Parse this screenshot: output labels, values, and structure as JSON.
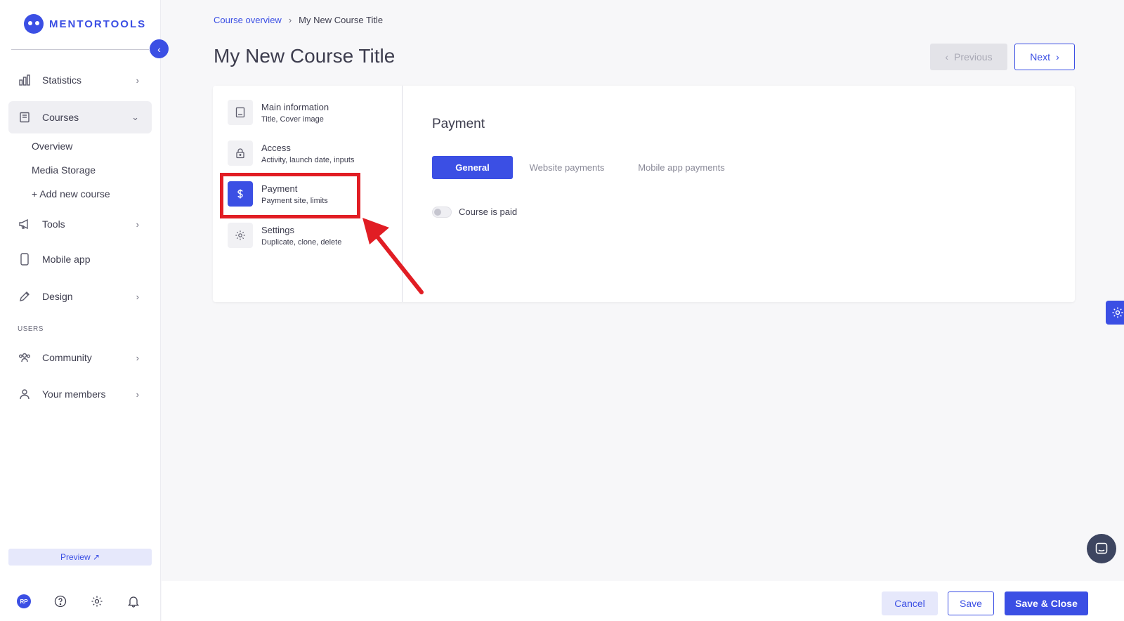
{
  "brand": {
    "name": "MENTORTOOLS",
    "accent": "#3b4fe4"
  },
  "sidebar": {
    "items": [
      {
        "label": "Statistics",
        "icon": "bar-chart-icon"
      },
      {
        "label": "Courses",
        "icon": "book-icon"
      },
      {
        "label": "Tools",
        "icon": "megaphone-icon"
      },
      {
        "label": "Mobile app",
        "icon": "mobile-icon"
      },
      {
        "label": "Design",
        "icon": "pencil-icon"
      },
      {
        "label": "Community",
        "icon": "community-icon"
      },
      {
        "label": "Your members",
        "icon": "user-icon"
      }
    ],
    "sub_items": [
      "Overview",
      "Media Storage",
      "+ Add new course"
    ],
    "section_users": "USERS",
    "preview_label": "Preview ↗",
    "avatar_initials": "RP"
  },
  "breadcrumb": {
    "link": "Course overview",
    "current": "My New Course Title"
  },
  "page": {
    "title": "My New Course Title"
  },
  "nav_buttons": {
    "previous": "Previous",
    "next": "Next"
  },
  "steps": [
    {
      "title": "Main information",
      "sub": "Title, Cover image",
      "icon": "document-icon"
    },
    {
      "title": "Access",
      "sub": "Activity, launch date, inputs",
      "icon": "lock-icon"
    },
    {
      "title": "Payment",
      "sub": "Payment site, limits",
      "icon": "dollar-icon"
    },
    {
      "title": "Settings",
      "sub": "Duplicate, clone, delete",
      "icon": "gear-icon"
    }
  ],
  "payment": {
    "title": "Payment",
    "tabs": [
      "General",
      "Website payments",
      "Mobile app payments"
    ],
    "toggle_label": "Course is paid"
  },
  "footer": {
    "cancel": "Cancel",
    "save": "Save",
    "save_close": "Save & Close"
  }
}
